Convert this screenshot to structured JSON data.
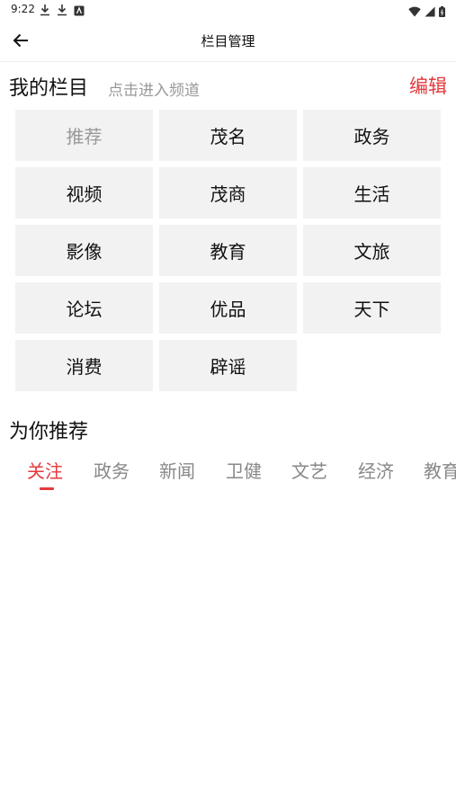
{
  "status_bar": {
    "time": "9:22",
    "icons": [
      "download-icon",
      "download-icon",
      "app-notification-icon",
      "wifi-icon",
      "signal-icon",
      "battery-icon"
    ]
  },
  "app_bar": {
    "back_icon": "arrow-left-icon",
    "title": "栏目管理"
  },
  "my_channels": {
    "title": "我的栏目",
    "hint": "点击进入频道",
    "edit_label": "编辑",
    "items": [
      {
        "label": "推荐",
        "fixed": true
      },
      {
        "label": "茂名"
      },
      {
        "label": "政务"
      },
      {
        "label": "视频"
      },
      {
        "label": "茂商"
      },
      {
        "label": "生活"
      },
      {
        "label": "影像"
      },
      {
        "label": "教育"
      },
      {
        "label": "文旅"
      },
      {
        "label": "论坛"
      },
      {
        "label": "优品"
      },
      {
        "label": "天下"
      },
      {
        "label": "消费"
      },
      {
        "label": "辟谣"
      }
    ]
  },
  "recommend": {
    "title": "为你推荐",
    "tabs": [
      {
        "label": "关注",
        "active": true
      },
      {
        "label": "政务"
      },
      {
        "label": "新闻"
      },
      {
        "label": "卫健"
      },
      {
        "label": "文艺"
      },
      {
        "label": "经济"
      },
      {
        "label": "教育"
      }
    ]
  },
  "colors": {
    "accent": "#e4393c",
    "tile_bg": "#f2f2f2",
    "muted_text": "#999999"
  }
}
